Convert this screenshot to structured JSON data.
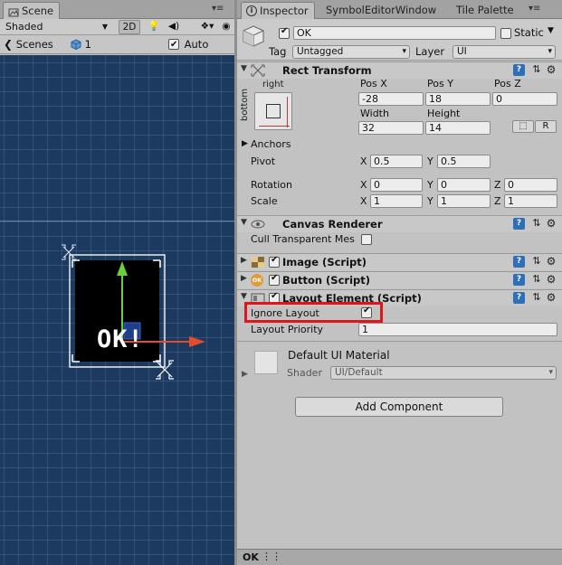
{
  "scene_panel": {
    "tab_title": "Scene",
    "toolbar": {
      "shading_mode": "Shaded",
      "mode_2d_label": "2D",
      "gizmos_label": "Auto Save"
    },
    "breadcrumb": {
      "scenes_label": "Scenes",
      "prefab_count": "1",
      "auto_save_checked": true
    },
    "viewport": {
      "button_text": "OK!",
      "colors": {
        "background": "#1c3a5f",
        "y_axis_handle": "#6ad13a",
        "x_axis_handle": "#e54b2c",
        "button_face": "#000000"
      }
    }
  },
  "inspector": {
    "tabs": [
      {
        "label": "Inspector",
        "active": true
      },
      {
        "label": "SymbolEditorWindow",
        "active": false
      },
      {
        "label": "Tile Palette",
        "active": false
      }
    ],
    "header": {
      "active_checked": true,
      "object_name": "OK",
      "static_label": "Static",
      "static_checked": false,
      "tag_label": "Tag",
      "tag_value": "Untagged",
      "layer_label": "Layer",
      "layer_value": "UI"
    },
    "rect_transform": {
      "title": "Rect Transform",
      "anchor_preset_label_top": "right",
      "anchor_preset_label_side": "bottom",
      "pos_x_label": "Pos X",
      "pos_y_label": "Pos Y",
      "pos_z_label": "Pos Z",
      "pos_x": "-28",
      "pos_y": "18",
      "pos_z": "0",
      "width_label": "Width",
      "height_label": "Height",
      "width": "32",
      "height": "14",
      "raw_edit_button": "R",
      "anchors_label": "Anchors",
      "pivot_label": "Pivot",
      "pivot_x": "0.5",
      "pivot_y": "0.5",
      "rotation_label": "Rotation",
      "rot_x": "0",
      "rot_y": "0",
      "rot_z": "0",
      "scale_label": "Scale",
      "scale_x": "1",
      "scale_y": "1",
      "scale_z": "1",
      "x_label": "X",
      "y_label": "Y",
      "z_label": "Z"
    },
    "canvas_renderer": {
      "title": "Canvas Renderer",
      "cull_label": "Cull Transparent Mes",
      "cull_checked": false
    },
    "image_script": {
      "title": "Image (Script)",
      "enabled": true
    },
    "button_script": {
      "title": "Button (Script)",
      "enabled": true,
      "icon_text": "OK"
    },
    "layout_element": {
      "title": "Layout Element (Script)",
      "enabled": true,
      "ignore_layout_label": "Ignore Layout",
      "ignore_layout_checked": true,
      "layout_priority_label": "Layout Priority",
      "layout_priority": "1",
      "highlight_color": "#e1131b"
    },
    "material": {
      "name": "Default UI Material",
      "shader_label": "Shader",
      "shader_value": "UI/Default"
    },
    "add_component_label": "Add Component",
    "bottom_label": "OK"
  }
}
